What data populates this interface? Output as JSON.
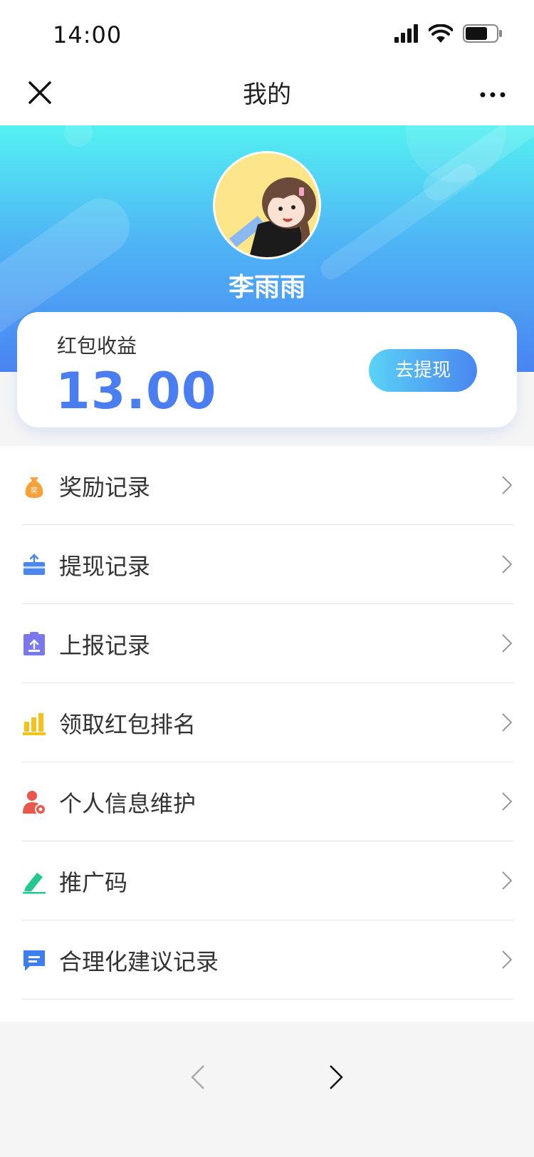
{
  "status_bar": {
    "time": "14:00",
    "icons": [
      "signal-icon",
      "wifi-icon",
      "battery-icon"
    ]
  },
  "nav": {
    "title": "我的",
    "close_icon": "close-icon",
    "more_icon": "more-icon"
  },
  "profile": {
    "name": "李雨雨",
    "avatar": "avatar-illustration"
  },
  "earnings": {
    "label": "红包收益",
    "amount": "13.00",
    "withdraw_label": "去提现"
  },
  "menu": {
    "items": [
      {
        "label": "奖励记录",
        "icon": "reward-bag-icon",
        "color": "#f7a23a"
      },
      {
        "label": "提现记录",
        "icon": "withdraw-box-icon",
        "color": "#4a86f1"
      },
      {
        "label": "上报记录",
        "icon": "report-clipboard-icon",
        "color": "#7b77ee"
      },
      {
        "label": "领取红包排名",
        "icon": "ranking-bars-icon",
        "color": "#f2c21b"
      },
      {
        "label": "个人信息维护",
        "icon": "user-settings-icon",
        "color": "#e8584c"
      },
      {
        "label": "推广码",
        "icon": "pencil-icon",
        "color": "#22c98d"
      },
      {
        "label": "合理化建议记录",
        "icon": "suggestion-chat-icon",
        "color": "#3d7ef0"
      }
    ]
  },
  "browser_nav": {
    "back_icon": "chevron-left-icon",
    "forward_icon": "chevron-right-icon"
  },
  "colors": {
    "accent": "#4a7ef0",
    "header_top": "#54f1f1",
    "header_bottom": "#4a84f2"
  }
}
